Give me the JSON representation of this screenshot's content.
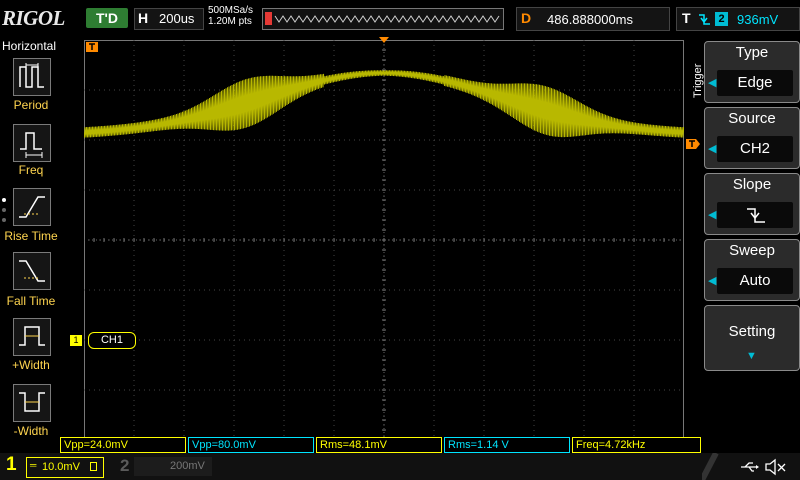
{
  "brand": "RIGOL",
  "topbar": {
    "run_status": "T'D",
    "timebase_key": "H",
    "timebase_value": "200us",
    "sample_rate": "500MSa/s",
    "memory_depth": "1.20M pts",
    "delay_key": "D",
    "delay_value": "486.888000ms",
    "trigger_key": "T",
    "trigger_source_number": "2",
    "trigger_level": "936mV"
  },
  "left_menu": {
    "title": "Horizontal",
    "items": [
      {
        "label": "Period",
        "icon": "period-icon"
      },
      {
        "label": "Freq",
        "icon": "freq-icon"
      },
      {
        "label": "Rise Time",
        "icon": "rise-time-icon"
      },
      {
        "label": "Fall Time",
        "icon": "fall-time-icon"
      },
      {
        "label": "+Width",
        "icon": "positive-width-icon"
      },
      {
        "label": "-Width",
        "icon": "negative-width-icon"
      }
    ]
  },
  "right_menu": {
    "section_label": "Trigger",
    "type_title": "Type",
    "type_value": "Edge",
    "source_title": "Source",
    "source_value": "CH2",
    "slope_title": "Slope",
    "sweep_title": "Sweep",
    "sweep_value": "Auto",
    "setting_title": "Setting"
  },
  "screen": {
    "channel_label": "CH1",
    "channel_marker": "1",
    "trace_color": "#b8b800"
  },
  "measurements": [
    {
      "text": "Vpp=24.0mV",
      "color": "#ffff00"
    },
    {
      "text": "Vpp=80.0mV",
      "color": "#00e5ff"
    },
    {
      "text": "Rms=48.1mV",
      "color": "#ffff00"
    },
    {
      "text": "Rms=1.14 V",
      "color": "#00e5ff"
    },
    {
      "text": "Freq=4.72kHz",
      "color": "#ffff00"
    }
  ],
  "bottom": {
    "ch1_number": "1",
    "ch1_scale": "10.0mV",
    "ch2_number": "2",
    "ch2_scale": "200mV"
  }
}
